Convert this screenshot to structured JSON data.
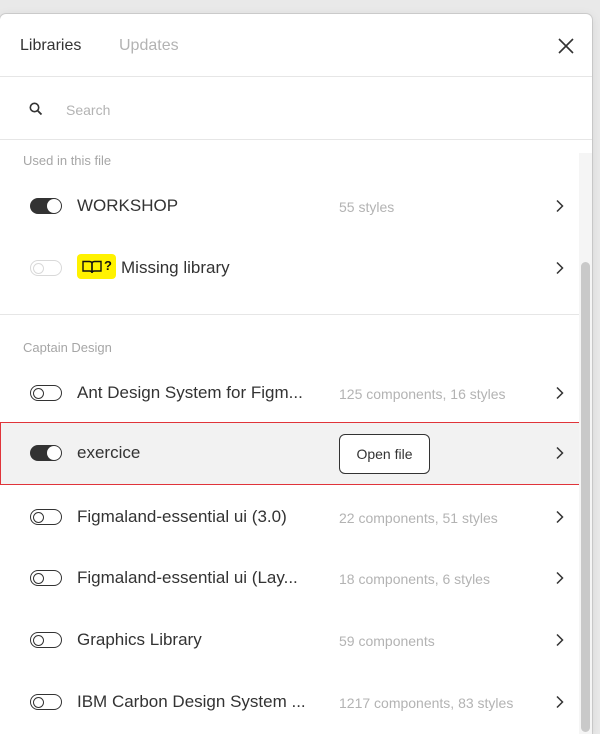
{
  "header": {
    "tabs": [
      {
        "label": "Libraries",
        "active": true
      },
      {
        "label": "Updates",
        "active": false
      }
    ],
    "close_icon": "close-icon"
  },
  "search": {
    "placeholder": "Search",
    "value": ""
  },
  "sections": [
    {
      "label": "Used in this file",
      "items": [
        {
          "name": "WORKSHOP",
          "meta": "55 styles",
          "enabled": true
        },
        {
          "name": "Missing library",
          "meta": "",
          "enabled": false,
          "missing": true,
          "badge_icon": "book-question-icon",
          "badge_text": "?"
        }
      ]
    },
    {
      "label": "Captain Design",
      "items": [
        {
          "name": "Ant Design System for Figm...",
          "meta": "125 components, 16 styles",
          "enabled": false
        },
        {
          "name": "exercice",
          "meta": "",
          "enabled": true,
          "selected": true,
          "action_label": "Open file"
        },
        {
          "name": "Figmaland-essential ui (3.0)",
          "meta": "22 components, 51 styles",
          "enabled": false
        },
        {
          "name": "Figmaland-essential ui (Lay...",
          "meta": "18 components, 6 styles",
          "enabled": false
        },
        {
          "name": "Graphics Library",
          "meta": "59 components",
          "enabled": false
        },
        {
          "name": "IBM Carbon Design System ...",
          "meta": "1217 components, 83 styles",
          "enabled": false
        }
      ]
    }
  ],
  "colors": {
    "selection_border": "#e0343a",
    "badge_yellow": "#fff200",
    "toggle_on": "#333333"
  }
}
